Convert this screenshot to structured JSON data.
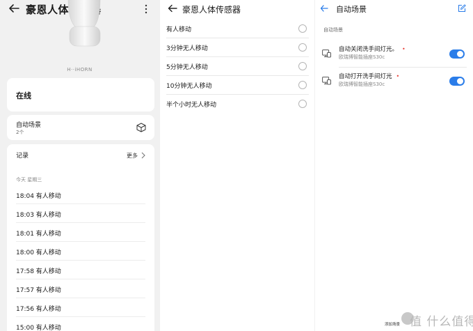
{
  "panel1": {
    "title": "豪恩人体传感器",
    "brand": "H··iHORN",
    "status": "在线",
    "auto_scene": {
      "label": "自动场景",
      "count": "2个"
    },
    "records": {
      "title": "记录",
      "more": "更多",
      "day": "今天 星期三",
      "items": [
        "18:04 有人移动",
        "18:03 有人移动",
        "18:01 有人移动",
        "18:00 有人移动",
        "17:58 有人移动",
        "17:57 有人移动",
        "17:56 有人移动",
        "15:00 有人移动"
      ]
    }
  },
  "panel2": {
    "title": "豪恩人体传感器",
    "options": [
      "有人移动",
      "3分钟无人移动",
      "5分钟无人移动",
      "10分钟无人移动",
      "半个小时无人移动"
    ]
  },
  "panel3": {
    "title": "自动场景",
    "section": "自动场景",
    "scenes": [
      {
        "name": "自动关闭洗手间灯光。",
        "device": "欧瑞博智能插座S30c",
        "enabled": true
      },
      {
        "name": "自动打开洗手间灯光",
        "device": "欧瑞博智能插座S30c",
        "enabled": true
      }
    ],
    "add_label": "添加场景"
  },
  "watermark": "值 什么值得买",
  "colors": {
    "accent": "#2b7de9",
    "required_dot": "#e8433b",
    "panel_bg": "#f1f1f1"
  }
}
